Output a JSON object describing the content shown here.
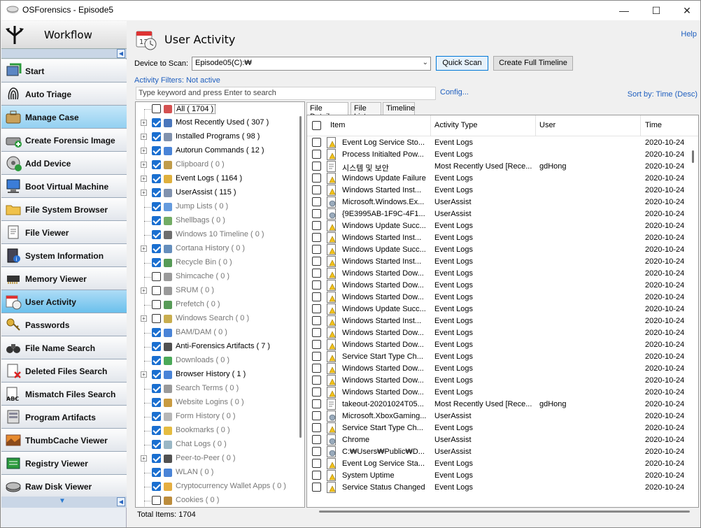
{
  "window": {
    "title": "OSForensics - Episode5",
    "minimize": "—",
    "maximize": "☐",
    "close": "✕"
  },
  "sidebar": {
    "header": "Workflow",
    "items": [
      {
        "label": "Start",
        "icon": "start-icon"
      },
      {
        "label": "Auto Triage",
        "icon": "fingerprint-icon"
      },
      {
        "label": "Manage Case",
        "icon": "briefcase-icon"
      },
      {
        "label": "Create Forensic Image",
        "icon": "drive-add-icon"
      },
      {
        "label": "Add Device",
        "icon": "add-device-icon"
      },
      {
        "label": "Boot Virtual Machine",
        "icon": "computer-icon"
      },
      {
        "label": "File System Browser",
        "icon": "folder-icon"
      },
      {
        "label": "File Viewer",
        "icon": "file-viewer-icon"
      },
      {
        "label": "System Information",
        "icon": "system-info-icon"
      },
      {
        "label": "Memory Viewer",
        "icon": "memory-icon"
      },
      {
        "label": "User Activity",
        "icon": "calendar-clock-icon"
      },
      {
        "label": "Passwords",
        "icon": "key-icon"
      },
      {
        "label": "File Name Search",
        "icon": "binoculars-icon"
      },
      {
        "label": "Deleted Files Search",
        "icon": "deleted-file-icon"
      },
      {
        "label": "Mismatch Files Search",
        "icon": "mismatch-icon"
      },
      {
        "label": "Program Artifacts",
        "icon": "program-icon"
      },
      {
        "label": "ThumbCache Viewer",
        "icon": "thumbnail-icon"
      },
      {
        "label": "Registry Viewer",
        "icon": "registry-icon"
      },
      {
        "label": "Raw Disk Viewer",
        "icon": "raw-disk-icon"
      }
    ]
  },
  "main": {
    "title": "User Activity",
    "help": "Help",
    "device_label": "Device to Scan:",
    "device_value": "Episode05(C):₩",
    "quick_scan": "Quick Scan",
    "create_timeline": "Create Full Timeline",
    "filters_label": "Activity Filters: Not active",
    "keyword_placeholder": "Type keyword and press Enter to search",
    "config": "Config...",
    "sort_by": "Sort by: Time (Desc)",
    "status": "Total Items: 1704"
  },
  "tree": [
    {
      "label": "All ( 1704 )",
      "checked": false,
      "exp": false,
      "dim": false
    },
    {
      "label": "Most Recently Used ( 307 )",
      "checked": true,
      "exp": true,
      "dim": false
    },
    {
      "label": "Installed Programs ( 98 )",
      "checked": true,
      "exp": true,
      "dim": false
    },
    {
      "label": "Autorun Commands ( 12 )",
      "checked": true,
      "exp": true,
      "dim": false
    },
    {
      "label": "Clipboard ( 0 )",
      "checked": true,
      "exp": true,
      "dim": true
    },
    {
      "label": "Event Logs ( 1164 )",
      "checked": true,
      "exp": true,
      "dim": false
    },
    {
      "label": "UserAssist ( 115 )",
      "checked": true,
      "exp": true,
      "dim": false
    },
    {
      "label": "Jump Lists ( 0 )",
      "checked": true,
      "exp": false,
      "dim": true
    },
    {
      "label": "Shellbags ( 0 )",
      "checked": true,
      "exp": false,
      "dim": true
    },
    {
      "label": "Windows 10 Timeline ( 0 )",
      "checked": true,
      "exp": false,
      "dim": true
    },
    {
      "label": "Cortana History ( 0 )",
      "checked": true,
      "exp": true,
      "dim": true
    },
    {
      "label": "Recycle Bin ( 0 )",
      "checked": true,
      "exp": false,
      "dim": true
    },
    {
      "label": "Shimcache ( 0 )",
      "checked": false,
      "exp": false,
      "dim": true
    },
    {
      "label": "SRUM ( 0 )",
      "checked": false,
      "exp": true,
      "dim": true
    },
    {
      "label": "Prefetch ( 0 )",
      "checked": false,
      "exp": false,
      "dim": true
    },
    {
      "label": "Windows Search ( 0 )",
      "checked": false,
      "exp": true,
      "dim": true
    },
    {
      "label": "BAM/DAM ( 0 )",
      "checked": true,
      "exp": false,
      "dim": true
    },
    {
      "label": "Anti-Forensics Artifacts ( 7 )",
      "checked": true,
      "exp": false,
      "dim": false
    },
    {
      "label": "Downloads ( 0 )",
      "checked": true,
      "exp": false,
      "dim": true
    },
    {
      "label": "Browser History ( 1 )",
      "checked": true,
      "exp": true,
      "dim": false
    },
    {
      "label": "Search Terms ( 0 )",
      "checked": true,
      "exp": false,
      "dim": true
    },
    {
      "label": "Website Logins ( 0 )",
      "checked": true,
      "exp": false,
      "dim": true
    },
    {
      "label": "Form History ( 0 )",
      "checked": true,
      "exp": false,
      "dim": true
    },
    {
      "label": "Bookmarks ( 0 )",
      "checked": true,
      "exp": false,
      "dim": true
    },
    {
      "label": "Chat Logs ( 0 )",
      "checked": true,
      "exp": false,
      "dim": true
    },
    {
      "label": "Peer-to-Peer ( 0 )",
      "checked": true,
      "exp": true,
      "dim": true
    },
    {
      "label": "WLAN ( 0 )",
      "checked": true,
      "exp": false,
      "dim": true
    },
    {
      "label": "Cryptocurrency Wallet Apps ( 0 )",
      "checked": true,
      "exp": false,
      "dim": true
    },
    {
      "label": "Cookies ( 0 )",
      "checked": false,
      "exp": false,
      "dim": true
    }
  ],
  "tabs": [
    "File Details",
    "File List",
    "Timeline"
  ],
  "columns": [
    "Item",
    "Activity Type",
    "User",
    "Time"
  ],
  "rows": [
    {
      "item": "Event Log Service Sto...",
      "type": "Event Logs",
      "user": "",
      "time": "2020-10-24",
      "icon": "warn"
    },
    {
      "item": "Process Initialted Pow...",
      "type": "Event Logs",
      "user": "",
      "time": "2020-10-24",
      "icon": "warn"
    },
    {
      "item": "시스템 및 보안",
      "type": "Most Recently Used [Rece...",
      "user": "gdHong",
      "time": "2020-10-24",
      "icon": "doc"
    },
    {
      "item": "Windows Update Failure",
      "type": "Event Logs",
      "user": "",
      "time": "2020-10-24",
      "icon": "warn"
    },
    {
      "item": "Windows Started Inst...",
      "type": "Event Logs",
      "user": "",
      "time": "2020-10-24",
      "icon": "warn"
    },
    {
      "item": "Microsoft.Windows.Ex...",
      "type": "UserAssist",
      "user": "",
      "time": "2020-10-24",
      "icon": "db"
    },
    {
      "item": "{9E3995AB-1F9C-4F1...",
      "type": "UserAssist",
      "user": "",
      "time": "2020-10-24",
      "icon": "db"
    },
    {
      "item": "Windows Update Succ...",
      "type": "Event Logs",
      "user": "",
      "time": "2020-10-24",
      "icon": "warn"
    },
    {
      "item": "Windows Started Inst...",
      "type": "Event Logs",
      "user": "",
      "time": "2020-10-24",
      "icon": "warn"
    },
    {
      "item": "Windows Update Succ...",
      "type": "Event Logs",
      "user": "",
      "time": "2020-10-24",
      "icon": "warn"
    },
    {
      "item": "Windows Started Inst...",
      "type": "Event Logs",
      "user": "",
      "time": "2020-10-24",
      "icon": "warn"
    },
    {
      "item": "Windows Started Dow...",
      "type": "Event Logs",
      "user": "",
      "time": "2020-10-24",
      "icon": "warn"
    },
    {
      "item": "Windows Started Dow...",
      "type": "Event Logs",
      "user": "",
      "time": "2020-10-24",
      "icon": "warn"
    },
    {
      "item": "Windows Started Dow...",
      "type": "Event Logs",
      "user": "",
      "time": "2020-10-24",
      "icon": "warn"
    },
    {
      "item": "Windows Update Succ...",
      "type": "Event Logs",
      "user": "",
      "time": "2020-10-24",
      "icon": "warn"
    },
    {
      "item": "Windows Started Inst...",
      "type": "Event Logs",
      "user": "",
      "time": "2020-10-24",
      "icon": "warn"
    },
    {
      "item": "Windows Started Dow...",
      "type": "Event Logs",
      "user": "",
      "time": "2020-10-24",
      "icon": "warn"
    },
    {
      "item": "Windows Started Dow...",
      "type": "Event Logs",
      "user": "",
      "time": "2020-10-24",
      "icon": "warn"
    },
    {
      "item": "Service Start Type Ch...",
      "type": "Event Logs",
      "user": "",
      "time": "2020-10-24",
      "icon": "warn"
    },
    {
      "item": "Windows Started Dow...",
      "type": "Event Logs",
      "user": "",
      "time": "2020-10-24",
      "icon": "warn"
    },
    {
      "item": "Windows Started Dow...",
      "type": "Event Logs",
      "user": "",
      "time": "2020-10-24",
      "icon": "warn"
    },
    {
      "item": "Windows Started Dow...",
      "type": "Event Logs",
      "user": "",
      "time": "2020-10-24",
      "icon": "warn"
    },
    {
      "item": "takeout-20201024T05...",
      "type": "Most Recently Used [Rece...",
      "user": "gdHong",
      "time": "2020-10-24",
      "icon": "doc"
    },
    {
      "item": "Microsoft.XboxGaming...",
      "type": "UserAssist",
      "user": "",
      "time": "2020-10-24",
      "icon": "db"
    },
    {
      "item": "Service Start Type Ch...",
      "type": "Event Logs",
      "user": "",
      "time": "2020-10-24",
      "icon": "warn"
    },
    {
      "item": "Chrome",
      "type": "UserAssist",
      "user": "",
      "time": "2020-10-24",
      "icon": "db"
    },
    {
      "item": "C:₩Users₩Public₩D...",
      "type": "UserAssist",
      "user": "",
      "time": "2020-10-24",
      "icon": "db"
    },
    {
      "item": "Event Log Service Sta...",
      "type": "Event Logs",
      "user": "",
      "time": "2020-10-24",
      "icon": "warn"
    },
    {
      "item": "System Uptime",
      "type": "Event Logs",
      "user": "",
      "time": "2020-10-24",
      "icon": "warn"
    },
    {
      "item": "Service Status Changed",
      "type": "Event Logs",
      "user": "",
      "time": "2020-10-24",
      "icon": "warn"
    }
  ]
}
